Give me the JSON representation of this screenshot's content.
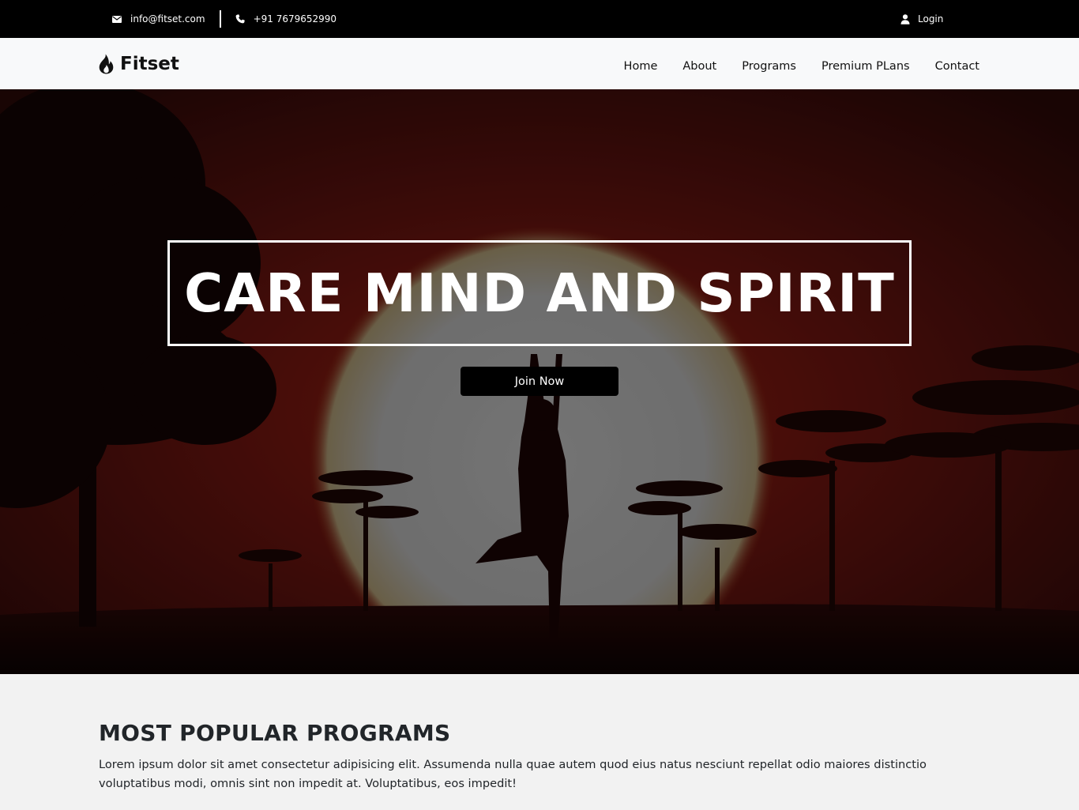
{
  "topbar": {
    "email": "info@fitset.com",
    "phone": "+91 7679652990",
    "login_label": "Login"
  },
  "navbar": {
    "brand": "Fitset",
    "links": [
      "Home",
      "About",
      "Programs",
      "Premium PLans",
      "Contact"
    ]
  },
  "hero": {
    "headline": "CARE MIND AND SPIRIT",
    "cta_label": "Join Now"
  },
  "programs": {
    "title": "MOST POPULAR PROGRAMS",
    "description": "Lorem ipsum dolor sit amet consectetur adipisicing elit. Assumenda nulla quae autem quod eius natus nesciunt repellat odio maiores distinctio voluptatibus modi, omnis sint non impedit at. Voluptatibus, eos impedit!"
  },
  "icons": {
    "email": "envelope-icon",
    "phone": "phone-icon",
    "login": "user-icon",
    "brand": "flame-icon"
  },
  "colors": {
    "topbar_bg": "#000000",
    "navbar_bg": "#f8f9fa",
    "section_bg": "#f2f2f2",
    "button_bg": "#000000"
  }
}
